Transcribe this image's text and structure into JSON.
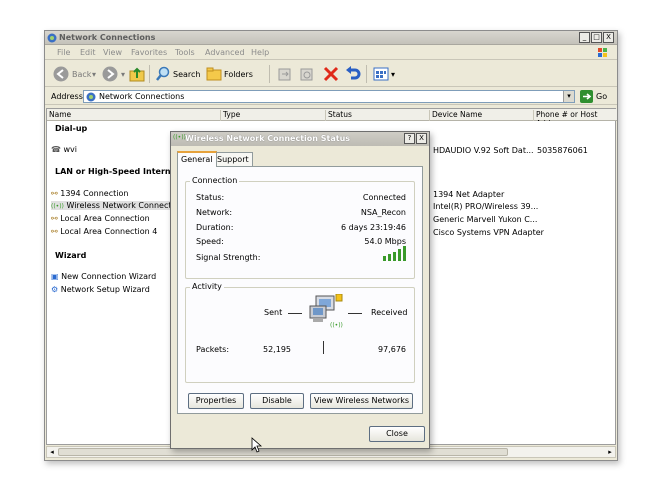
{
  "window": {
    "title": "Network Connections",
    "controls": [
      "_",
      "□",
      "X"
    ]
  },
  "menu": [
    "File",
    "Edit",
    "View",
    "Favorites",
    "Tools",
    "Advanced",
    "Help"
  ],
  "toolbar": {
    "back_label": "Back",
    "search_label": "Search",
    "folders_label": "Folders"
  },
  "address": {
    "label": "Address",
    "value": "Network Connections",
    "go_label": "Go"
  },
  "columns": [
    "Name",
    "Type",
    "Status",
    "Device Name",
    "Phone # or Host Addre"
  ],
  "groups": {
    "dialup": "Dial-up",
    "lan": "LAN or High-Speed Internet",
    "wizard": "Wizard"
  },
  "items": {
    "dialup": [
      {
        "name": "wvi",
        "device": "HDAUDIO V.92 Soft Dat...",
        "phone": "5035876061"
      }
    ],
    "lan": [
      {
        "name": "1394 Connection",
        "device": "1394 Net Adapter"
      },
      {
        "name": "Wireless Network Connection",
        "device": "Intel(R) PRO/Wireless 39..."
      },
      {
        "name": "Local Area Connection",
        "device": "Generic Marvell Yukon C..."
      },
      {
        "name": "Local Area Connection 4",
        "device": "Cisco Systems VPN Adapter"
      }
    ],
    "wizard": [
      {
        "name": "New Connection Wizard"
      },
      {
        "name": "Network Setup Wizard"
      }
    ]
  },
  "dialog": {
    "title": "Wireless Network Connection Status",
    "help": "?",
    "close_x": "X",
    "tabs": [
      "General",
      "Support"
    ],
    "connection": {
      "group_label": "Connection",
      "status_label": "Status:",
      "status_value": "Connected",
      "network_label": "Network:",
      "network_value": "NSA_Recon",
      "duration_label": "Duration:",
      "duration_value": "6 days 23:19:46",
      "speed_label": "Speed:",
      "speed_value": "54.0 Mbps",
      "signal_label": "Signal Strength:"
    },
    "activity": {
      "group_label": "Activity",
      "sent_label": "Sent",
      "received_label": "Received",
      "packets_label": "Packets:",
      "packets_sent": "52,195",
      "packets_received": "97,676"
    },
    "buttons": {
      "properties": "Properties",
      "disable": "Disable",
      "view_wireless": "View Wireless Networks",
      "close": "Close"
    }
  },
  "colors": {
    "window_face": "#ece9d8",
    "signal_green": "#3a9a2a",
    "go_green": "#2f8f2f"
  }
}
